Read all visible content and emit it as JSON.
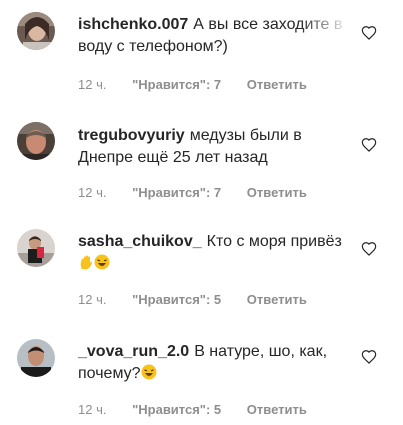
{
  "comments": [
    {
      "username": "ishchenko.007",
      "text": "А вы все заходите в воду с телефоном?)",
      "time": "12 ч.",
      "likes": "\"Нравится\": 7",
      "reply": "Ответить",
      "avatar_icon": "avatar-photo-woman",
      "emoji": []
    },
    {
      "username": "tregubovyuriy",
      "text": "медузы были в Днепре ещё 25 лет назад",
      "time": "12 ч.",
      "likes": "\"Нравится\": 7",
      "reply": "Ответить",
      "avatar_icon": "avatar-photo-man",
      "emoji": []
    },
    {
      "username": "sasha_chuikov_",
      "text": "Кто с моря привёз",
      "time": "12 ч.",
      "likes": "\"Нравится\": 5",
      "reply": "Ответить",
      "avatar_icon": "avatar-photo-mirror-selfie",
      "emoji": [
        "hand-emoji",
        "laughing-emoji"
      ]
    },
    {
      "username": "_vova_run_2.0",
      "text": "В натуре, шо, как, почему?",
      "time": "12 ч.",
      "likes": "\"Нравится\": 5",
      "reply": "Ответить",
      "avatar_icon": "avatar-photo-man-dark",
      "emoji": [
        "laughing-emoji"
      ]
    }
  ],
  "colors": {
    "text": "#262626",
    "meta": "#8e8e8e",
    "emoji": "#f7c21b"
  },
  "like_icon": "heart-outline-icon"
}
